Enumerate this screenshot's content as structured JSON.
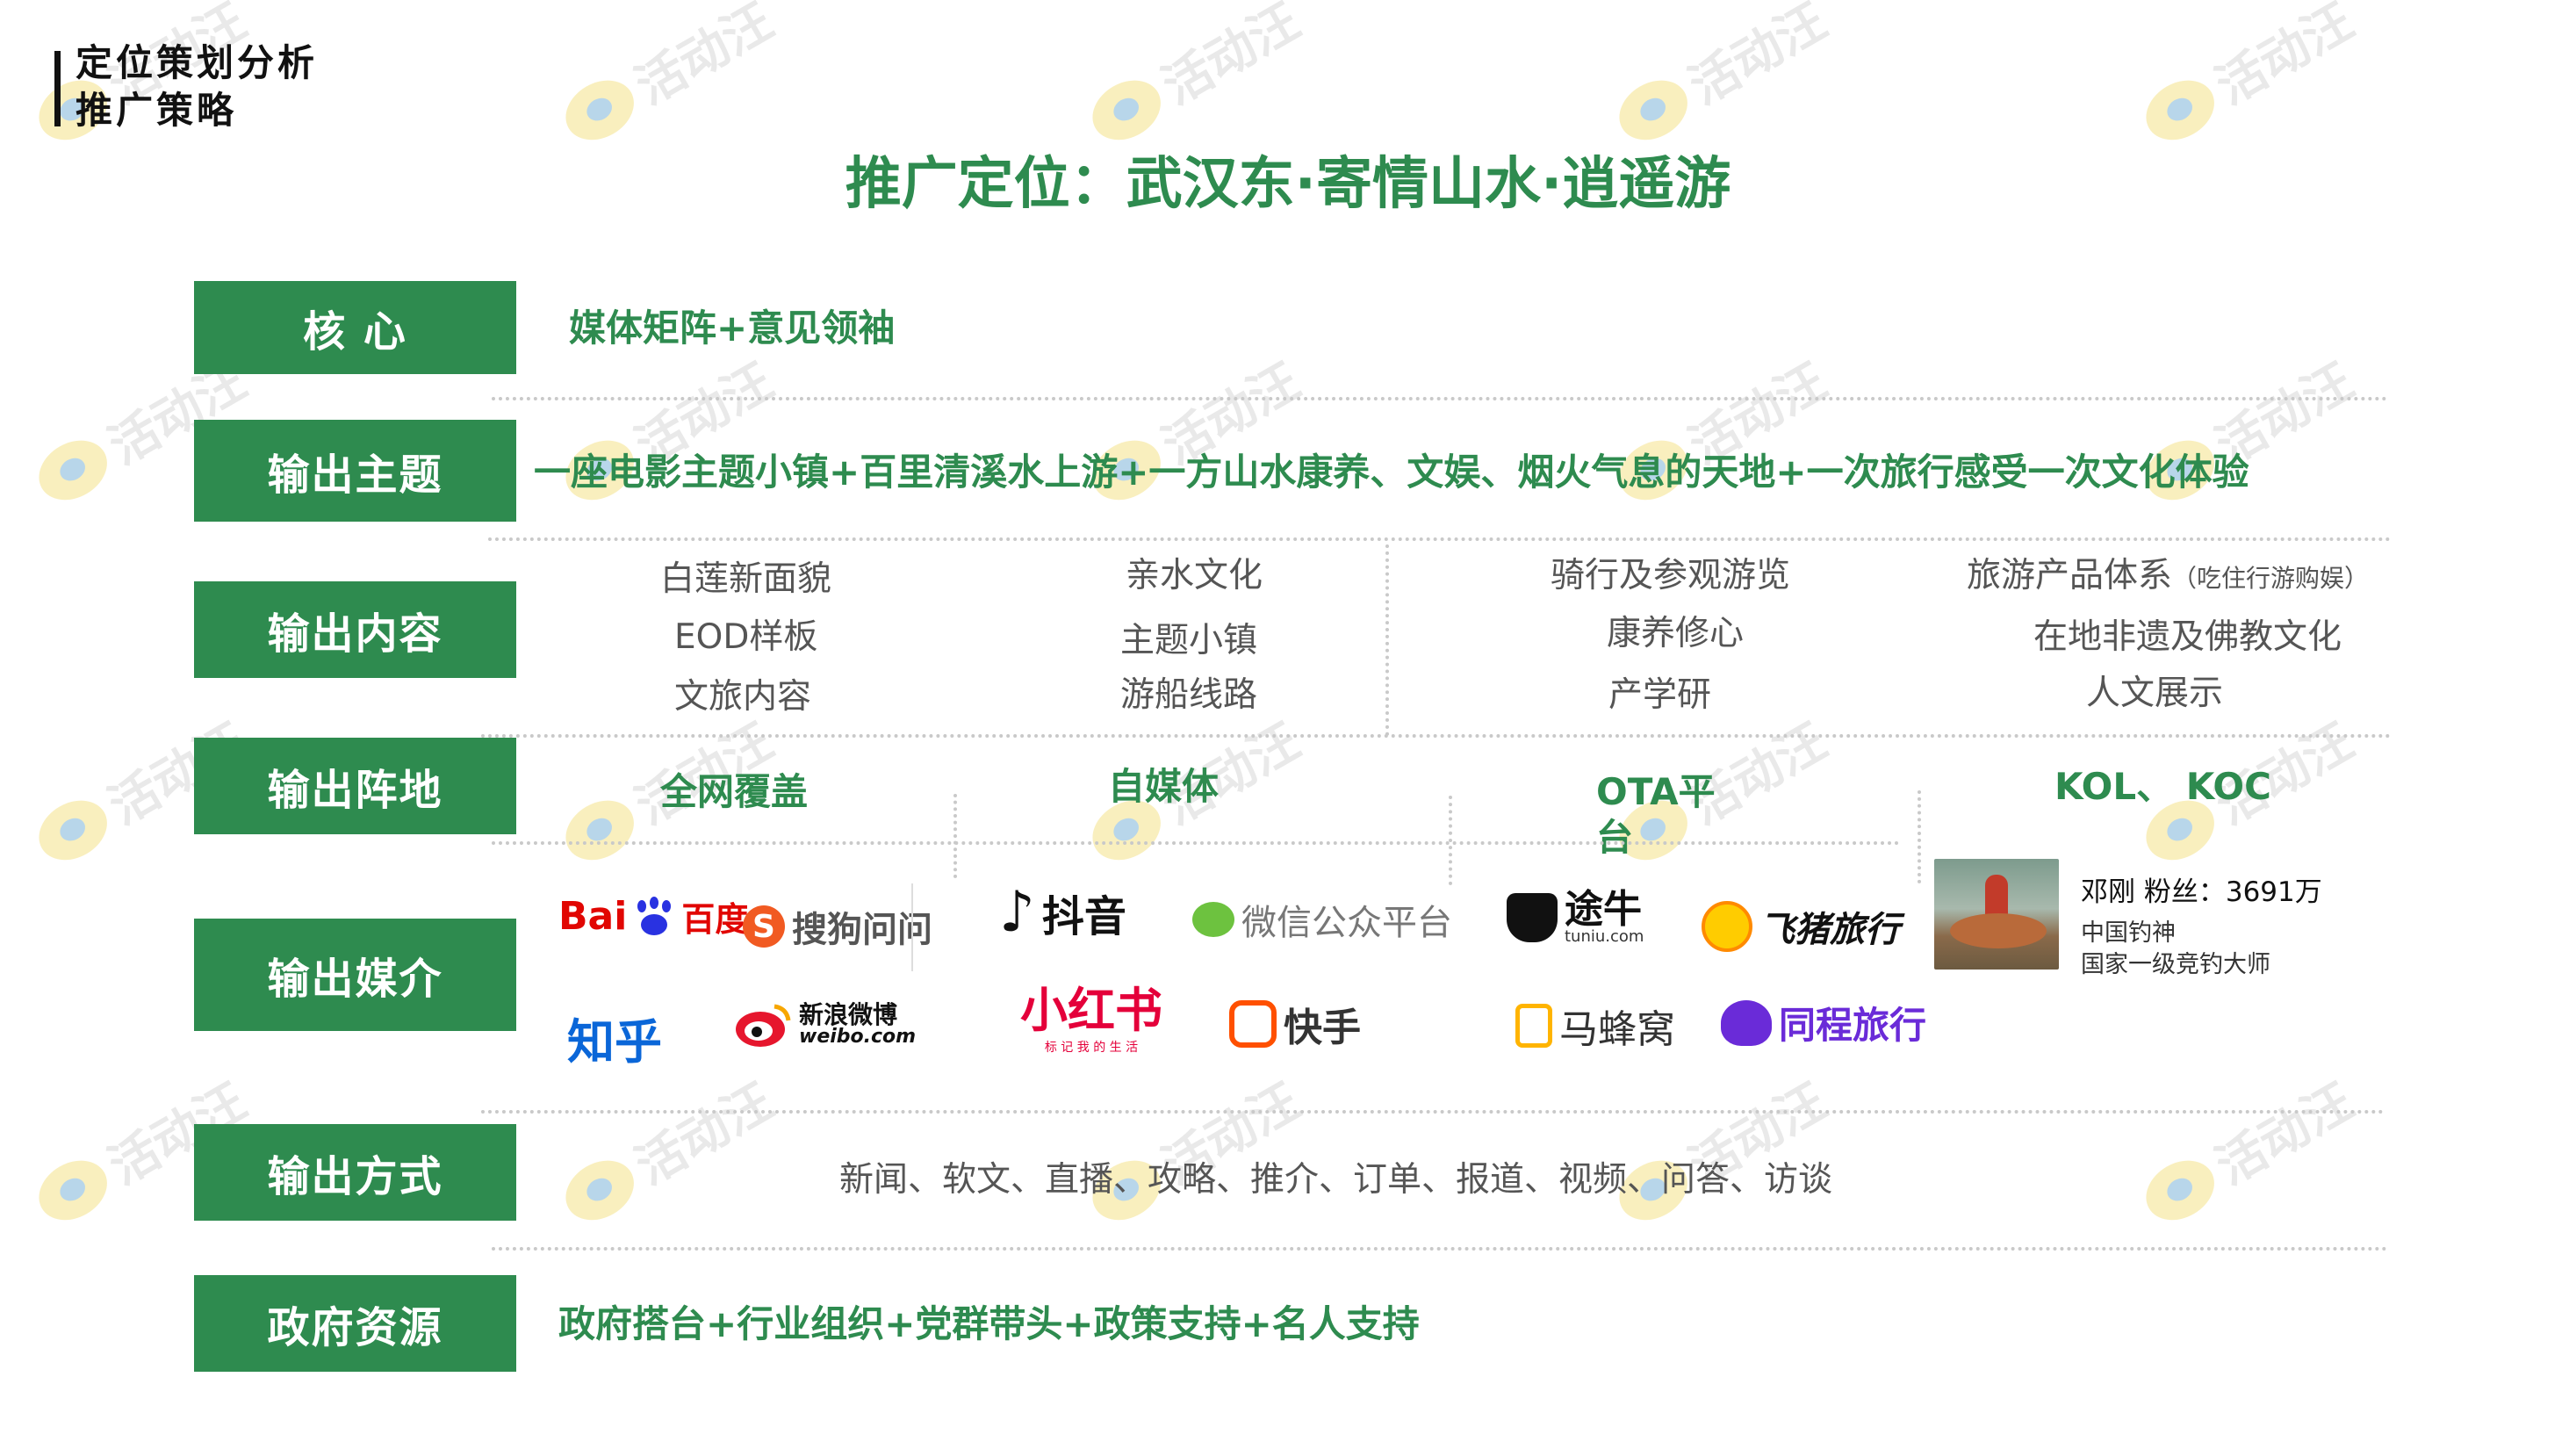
{
  "header": {
    "line1": "定位策划分析",
    "line2": "推广策略"
  },
  "title": "推广定位：武汉东·寄情山水·逍遥游",
  "rows": {
    "core": {
      "label": "核 心",
      "text": "媒体矩阵+意见领袖"
    },
    "theme": {
      "label": "输出主题",
      "text": "一座电影主题小镇+百里清溪水上游+一方山水康养、文娱、烟火气息的天地+一次旅行感受一次文化体验"
    },
    "content": {
      "label": "输出内容",
      "col1": [
        "白莲新面貌",
        "EOD样板",
        "文旅内容"
      ],
      "col2": [
        "亲水文化",
        "主题小镇",
        "游船线路"
      ],
      "col3": [
        "骑行及参观游览",
        "康养修心",
        "产学研"
      ],
      "col4_main": "旅游产品体系",
      "col4_note": "（吃住行游购娱）",
      "col4_items": [
        "在地非遗及佛教文化",
        "人文展示"
      ]
    },
    "platforms": {
      "label": "输出阵地",
      "items": [
        "全网覆盖",
        "自媒体",
        "OTA平台",
        "KOL、 KOC"
      ]
    },
    "media": {
      "label": "输出媒介",
      "baidu": {
        "prefix": "Bai",
        "suffix": "百度"
      },
      "sogou": "搜狗问问",
      "zhihu": "知乎",
      "weibo": {
        "cn": "新浪微博",
        "en": "weibo.com"
      },
      "douyin": "抖音",
      "wechat": "微信公众平台",
      "xiaohongshu": {
        "main": "小红书",
        "sub": "标 记 我 的 生 活"
      },
      "kuaishou": "快手",
      "tuniu": {
        "main": "途牛",
        "sub": "tuniu.com"
      },
      "fliggy": "飞猪旅行",
      "mafengwo": "马蜂窝",
      "tongcheng": "同程旅行",
      "kol": {
        "name_line": "邓刚 粉丝：3691万",
        "title1": "中国钓神",
        "title2": "国家一级竞钓大师"
      }
    },
    "method": {
      "label": "输出方式",
      "text": "新闻、软文、直播、攻略、推介、订单、报道、视频、问答、访谈"
    },
    "gov": {
      "label": "政府资源",
      "text": "政府搭台+行业组织+党群带头+政策支持+名人支持"
    }
  },
  "watermark": "活动汪",
  "colors": {
    "accent": "#2e8b4f",
    "separator": "#c9c9c9"
  }
}
